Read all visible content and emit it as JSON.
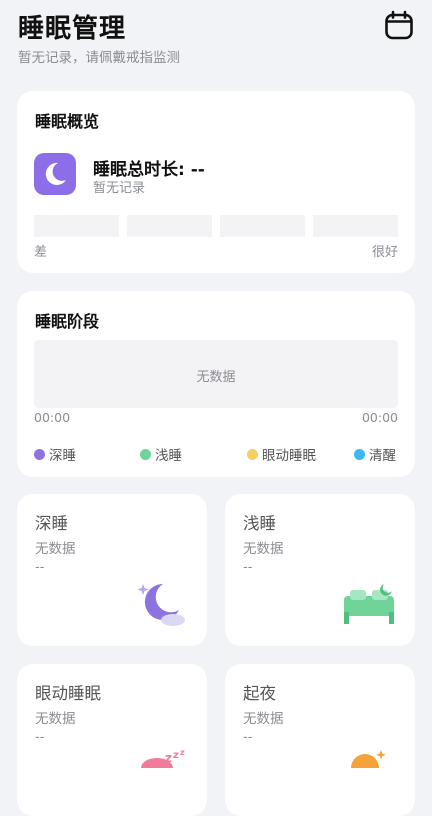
{
  "header": {
    "title": "睡眠管理",
    "subtitle": "暂无记录，请佩戴戒指监测",
    "calendar_icon": "calendar-icon"
  },
  "overview": {
    "title": "睡眠概览",
    "total_label": "睡眠总时长: --",
    "total_sub": "暂无记录",
    "scale_low": "差",
    "scale_high": "很好",
    "moon_color": "#8C6FE8"
  },
  "stages": {
    "title": "睡眠阶段",
    "empty_text": "无数据",
    "time_start": "00:00",
    "time_end": "00:00",
    "legend": [
      {
        "label": "深睡",
        "color": "#8C73E0"
      },
      {
        "label": "浅睡",
        "color": "#6FD39A"
      },
      {
        "label": "眼动睡眠",
        "color": "#F5CF63"
      },
      {
        "label": "清醒",
        "color": "#3DB8F0"
      }
    ]
  },
  "tiles": [
    {
      "title": "深睡",
      "status": "无数据",
      "value": "--",
      "icon": "moon-stars-icon"
    },
    {
      "title": "浅睡",
      "status": "无数据",
      "value": "--",
      "icon": "bed-icon"
    },
    {
      "title": "眼动睡眠",
      "status": "无数据",
      "value": "--",
      "icon": "zzz-icon"
    },
    {
      "title": "起夜",
      "status": "无数据",
      "value": "--",
      "icon": "night-wake-icon"
    }
  ]
}
